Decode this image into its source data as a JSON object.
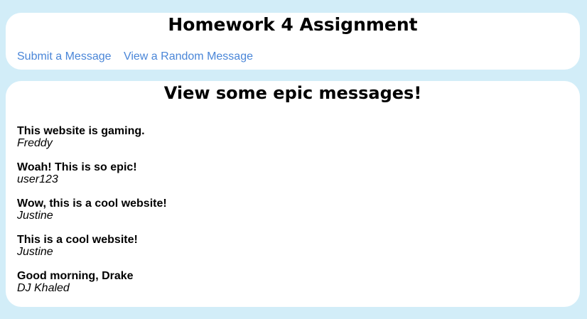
{
  "header": {
    "title": "Homework 4 Assignment",
    "nav": [
      {
        "label": "Submit a Message"
      },
      {
        "label": "View a Random Message"
      }
    ],
    "link_color": "#4a86d8"
  },
  "main": {
    "title": "View some epic messages!",
    "messages": [
      {
        "text": "This website is gaming.",
        "author": "Freddy"
      },
      {
        "text": "Woah! This is so epic!",
        "author": "user123"
      },
      {
        "text": "Wow, this is a cool website!",
        "author": "Justine"
      },
      {
        "text": "This is a cool website!",
        "author": "Justine"
      },
      {
        "text": "Good morning, Drake",
        "author": "DJ Khaled"
      }
    ]
  },
  "colors": {
    "background": "#d2edf8",
    "panel": "#ffffff"
  }
}
